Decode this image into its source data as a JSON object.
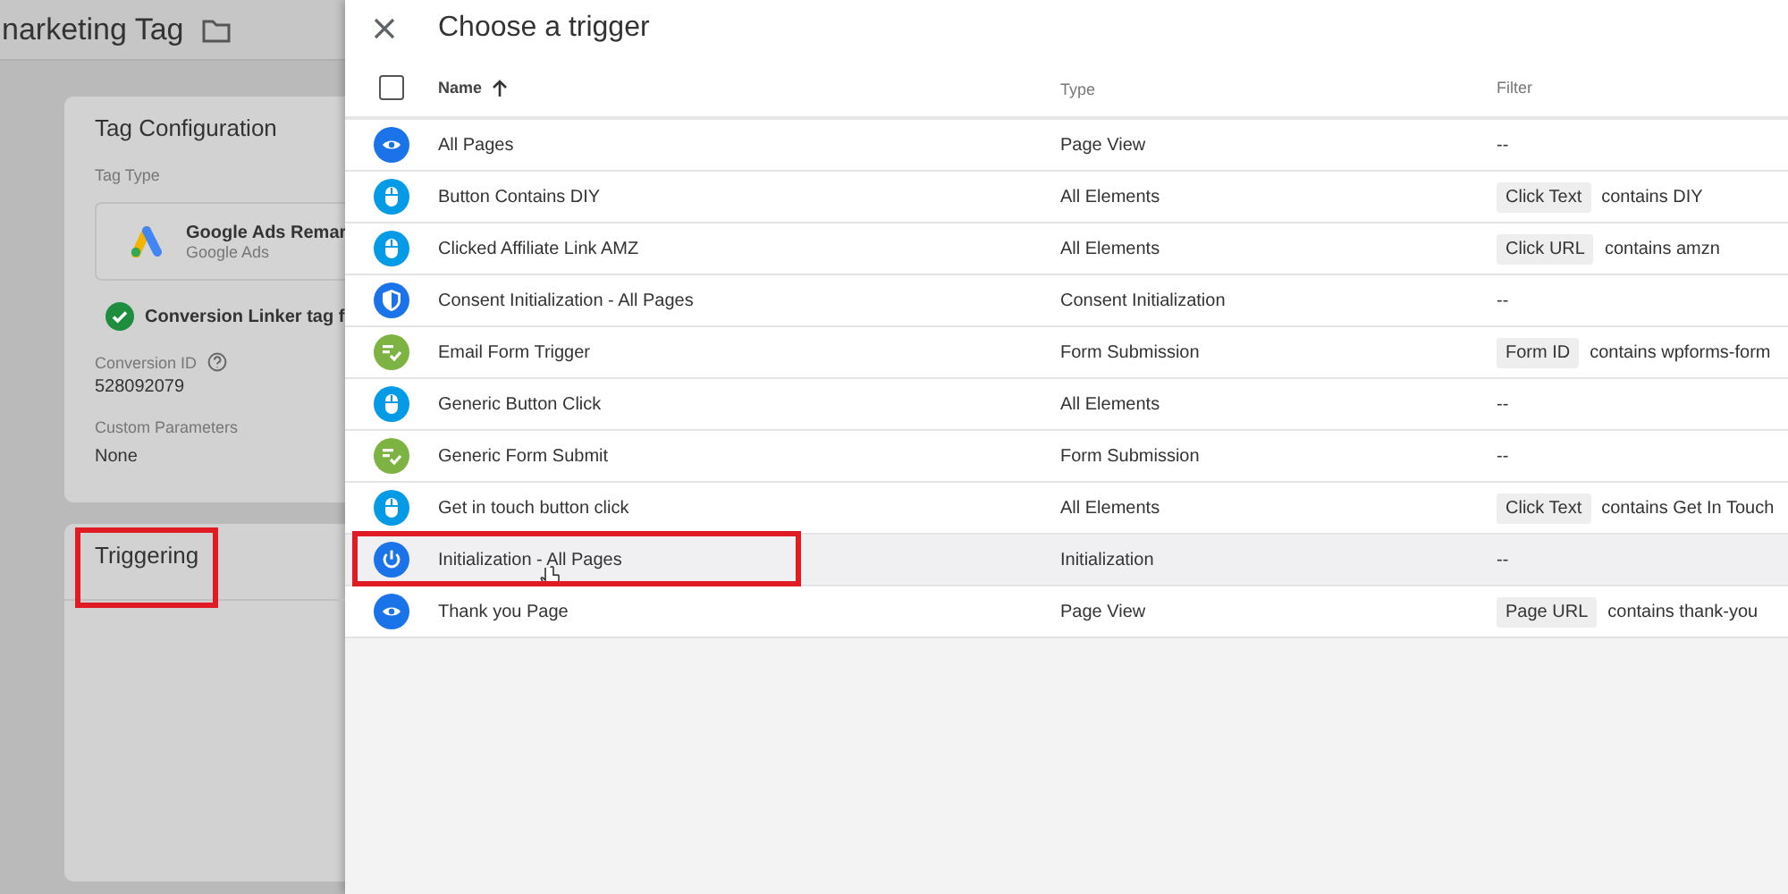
{
  "background_page": {
    "title": "narketing Tag",
    "tag_configuration": {
      "heading": "Tag Configuration",
      "tag_type_label": "Tag Type",
      "tag_type": {
        "name": "Google Ads Remar",
        "vendor": "Google Ads"
      },
      "linker_note": "Conversion Linker tag f",
      "conversion_id_label": "Conversion ID",
      "conversion_id": "528092079",
      "custom_parameters_label": "Custom Parameters",
      "custom_parameters": "None"
    },
    "triggering": {
      "heading": "Triggering",
      "highlighted": true
    }
  },
  "dialog": {
    "title": "Choose a trigger",
    "select_all": {
      "checked": false
    },
    "columns": [
      {
        "label": "Name",
        "sorted": true
      },
      {
        "label": "Type",
        "sorted": false
      },
      {
        "label": "Filter",
        "sorted": false
      }
    ],
    "rows": [
      {
        "kind": "pageview",
        "name": "All Pages",
        "type": "Page View",
        "filter_text": "--",
        "hovered": false,
        "highlighted": false
      },
      {
        "kind": "click",
        "name": "Button Contains DIY",
        "type": "All Elements",
        "filter_variable": "Click Text",
        "filter_text": "contains DIY",
        "hovered": false,
        "highlighted": false
      },
      {
        "kind": "click",
        "name": "Clicked Affiliate Link AMZ",
        "type": "All Elements",
        "filter_variable": "Click URL",
        "filter_text": "contains amzn",
        "hovered": false,
        "highlighted": false
      },
      {
        "kind": "consent",
        "name": "Consent Initialization - All Pages",
        "type": "Consent Initialization",
        "filter_text": "--",
        "hovered": false,
        "highlighted": false
      },
      {
        "kind": "form",
        "name": "Email Form Trigger",
        "type": "Form Submission",
        "filter_variable": "Form ID",
        "filter_text": "contains wpforms-form",
        "hovered": false,
        "highlighted": false
      },
      {
        "kind": "click",
        "name": "Generic Button Click",
        "type": "All Elements",
        "filter_text": "--",
        "hovered": false,
        "highlighted": false
      },
      {
        "kind": "form",
        "name": "Generic Form Submit",
        "type": "Form Submission",
        "filter_text": "--",
        "hovered": false,
        "highlighted": false
      },
      {
        "kind": "click",
        "name": "Get in touch button click",
        "type": "All Elements",
        "filter_variable": "Click Text",
        "filter_text": "contains Get In Touch",
        "hovered": false,
        "highlighted": false
      },
      {
        "kind": "init",
        "name": "Initialization - All Pages",
        "type": "Initialization",
        "filter_text": "--",
        "hovered": true,
        "highlighted": true
      },
      {
        "kind": "pageview",
        "name": "Thank you Page",
        "type": "Page View",
        "filter_variable": "Page URL",
        "filter_text": "contains thank-you",
        "hovered": false,
        "highlighted": false
      }
    ]
  }
}
